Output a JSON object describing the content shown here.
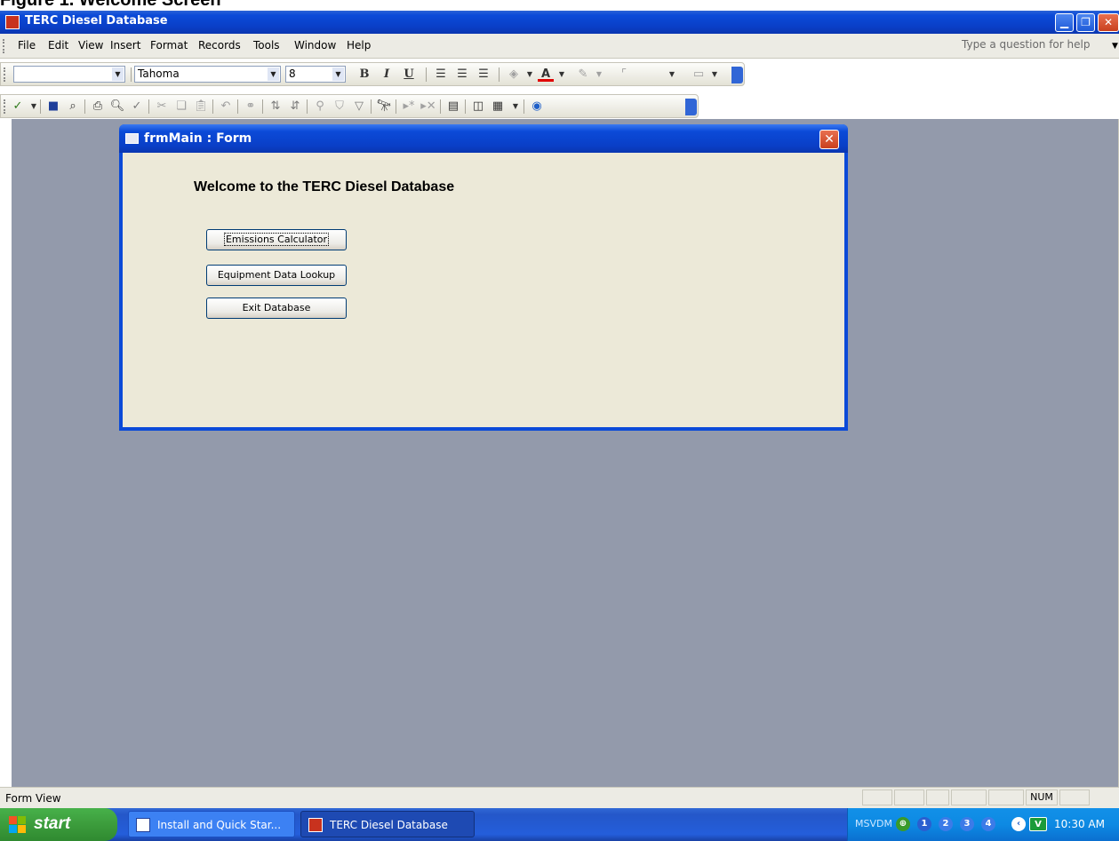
{
  "figure_caption": "Figure 1. Welcome Screen",
  "app": {
    "title": "TERC Diesel Database",
    "help_placeholder": "Type a question for help"
  },
  "menu": [
    "File",
    "Edit",
    "View",
    "Insert",
    "Format",
    "Records",
    "Tools",
    "Window",
    "Help"
  ],
  "formatting_toolbar": {
    "object_value": "",
    "font_name": "Tahoma",
    "font_size": "8",
    "bold": "B",
    "italic": "I",
    "underline": "U"
  },
  "form": {
    "title": "frmMain : Form",
    "heading": "Welcome to the TERC Diesel Database",
    "buttons": {
      "emissions": "Emissions Calculator",
      "equipment": "Equipment Data Lookup",
      "exit": "Exit Database"
    }
  },
  "status": {
    "left_text": "Form View",
    "num": "NUM"
  },
  "taskbar": {
    "start_label": "start",
    "tasks": [
      "Install and Quick Star...",
      "TERC Diesel Database"
    ],
    "tray_text": "MSVDM",
    "tray_numbers": [
      "1",
      "2",
      "3",
      "4"
    ],
    "clock": "10:30 AM"
  },
  "colors": {
    "xp_blue": "#0b4ad8",
    "mdi_background": "#939aab",
    "form_face": "#ece9d8",
    "start_green": "#3c9c3c"
  }
}
